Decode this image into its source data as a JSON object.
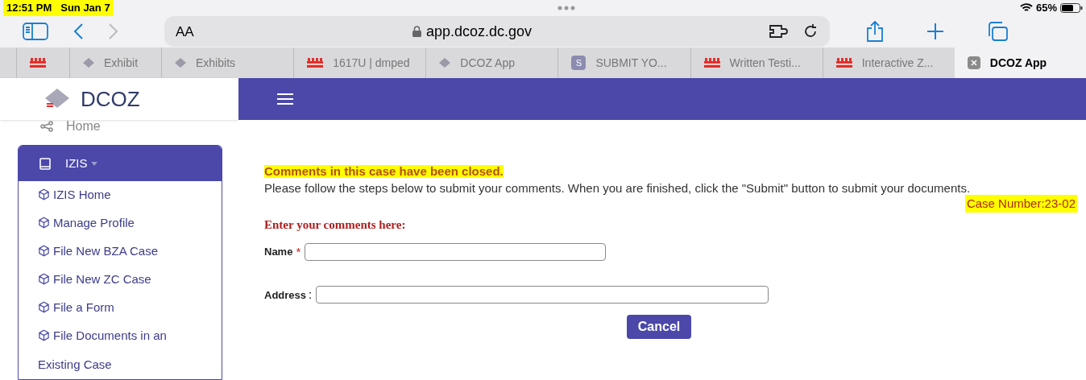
{
  "status_bar": {
    "time": "12:51 PM",
    "date": "Sun Jan 7",
    "highlighted": true,
    "battery": "65%"
  },
  "toolbar": {
    "text_size": "AA",
    "url": "app.dcoz.dc.gov"
  },
  "tabs": [
    {
      "kind": "flag",
      "selected": false
    },
    {
      "kind": "diamond",
      "label": "Exhibit",
      "selected": false
    },
    {
      "kind": "diamond",
      "label": "Exhibits",
      "selected": false
    },
    {
      "kind": "flag",
      "label": "1617U | dmped",
      "selected": false
    },
    {
      "kind": "diamond",
      "label": "DCOZ App",
      "selected": false
    },
    {
      "kind": "letter",
      "letter": "S",
      "label": "SUBMIT YO...",
      "selected": false
    },
    {
      "kind": "flag",
      "label": "Written Testi...",
      "selected": false
    },
    {
      "kind": "flag",
      "label": "Interactive Z...",
      "selected": false
    },
    {
      "kind": "close",
      "label": "DCOZ App",
      "selected": true
    }
  ],
  "app": {
    "brand": "DCOZ",
    "breadcrumb": "Home"
  },
  "sidebar": {
    "title": "IZIS",
    "expanded": true,
    "items": [
      "IZIS Home",
      "Manage Profile",
      "File New BZA Case",
      "File New ZC Case",
      "File a Form",
      "File Documents in an Existing Case"
    ]
  },
  "content": {
    "notice": "Comments in this case have been closed.",
    "notice_highlighted": true,
    "instructions": "Please follow the steps below to submit your comments. When you are finished, click the \"Submit\" button to submit your documents.",
    "case_number": "Case Number:23-02",
    "case_highlighted": true,
    "heading": "Enter your comments here:",
    "fields": [
      {
        "label": "Name",
        "kind": "required",
        "mark": "*"
      },
      {
        "label": "Address",
        "kind": "plain",
        "mark": ":"
      }
    ],
    "button": "Cancel"
  }
}
